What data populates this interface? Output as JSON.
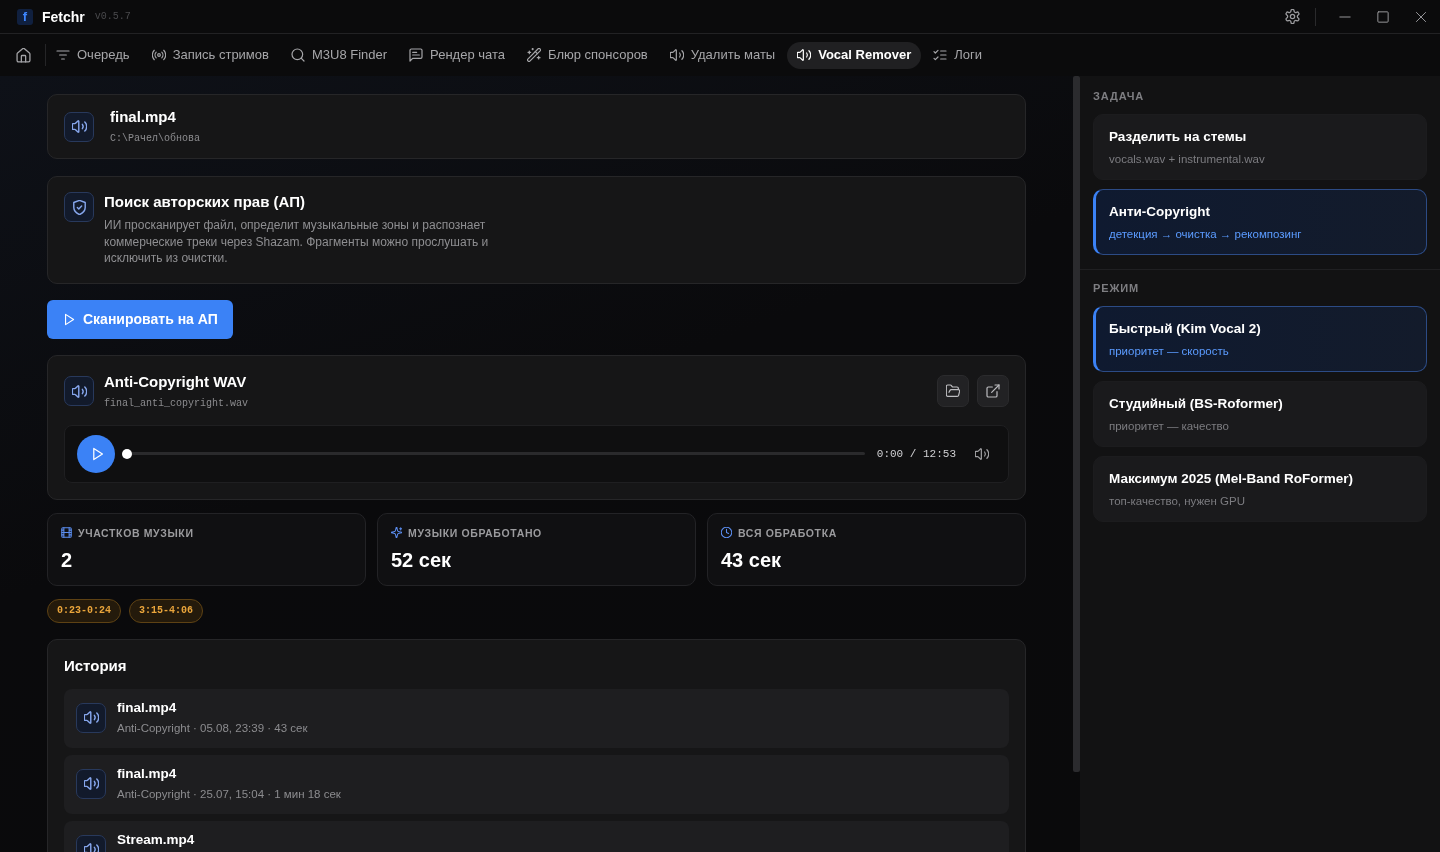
{
  "window": {
    "logo": "f",
    "app_name": "Fetchr",
    "version": "v0.5.7"
  },
  "tabs": [
    {
      "label": "Очередь",
      "selected": false
    },
    {
      "label": "Запись стримов",
      "selected": false
    },
    {
      "label": "M3U8 Finder",
      "selected": false
    },
    {
      "label": "Рендер чата",
      "selected": false
    },
    {
      "label": "Блюр спонсоров",
      "selected": false
    },
    {
      "label": "Удалить маты",
      "selected": false
    },
    {
      "label": "Vocal Remover",
      "selected": true
    },
    {
      "label": "Логи",
      "selected": false
    }
  ],
  "source_file": {
    "name": "final.mp4",
    "path": "C:\\Рачел\\обнова"
  },
  "copyright_scan": {
    "title": "Поиск авторских прав (АП)",
    "description": "ИИ просканирует файл, определит музыкальные зоны и распознает коммерческие треки через Shazam. Фрагменты можно прослушать и исключить из очистки."
  },
  "scan_button": {
    "label": "Сканировать на АП"
  },
  "output": {
    "title": "Anti-Copyright WAV",
    "file": "final_anti_copyright.wav",
    "player": {
      "level": 0,
      "time": "0:00 / 12:53"
    }
  },
  "stats": [
    {
      "label": "УЧАСТКОВ МУЗЫКИ",
      "value": "2"
    },
    {
      "label": "МУЗЫКИ ОБРАБОТАНО",
      "value": "52 сек"
    },
    {
      "label": "ВСЯ ОБРАБОТКА",
      "value": "43 сек"
    }
  ],
  "music_segments": [
    "0:23-0:24",
    "3:15-4:06"
  ],
  "history": {
    "title": "История",
    "items": [
      {
        "name": "final.mp4",
        "details": "Anti-Copyright · 05.08, 23:39 · 43 сек"
      },
      {
        "name": "final.mp4",
        "details": "Anti-Copyright · 25.07, 15:04 · 1 мин 18 сек"
      },
      {
        "name": "Stream.mp4"
      }
    ]
  },
  "sidebar": {
    "sections": [
      {
        "title": "ЗАДАЧА",
        "options": [
          {
            "title": "Разделить на стемы",
            "subtitle": "vocals.wav + instrumental.wav",
            "selected": false
          },
          {
            "title": "Анти-Copyright",
            "subtitle": "детекция → очистка → рекомпозинг",
            "selected": true
          }
        ]
      },
      {
        "title": "РЕЖИМ",
        "options": [
          {
            "title": "Быстрый (Kim Vocal 2)",
            "subtitle": "приоритет — скорость",
            "selected": true
          },
          {
            "title": "Студийный (BS-Roformer)",
            "subtitle": "приоритет — качество",
            "selected": false
          },
          {
            "title": "Максимум 2025 (Mel-Band RoFormer)",
            "subtitle": "топ-качество, нужен GPU",
            "selected": false
          }
        ]
      }
    ]
  }
}
